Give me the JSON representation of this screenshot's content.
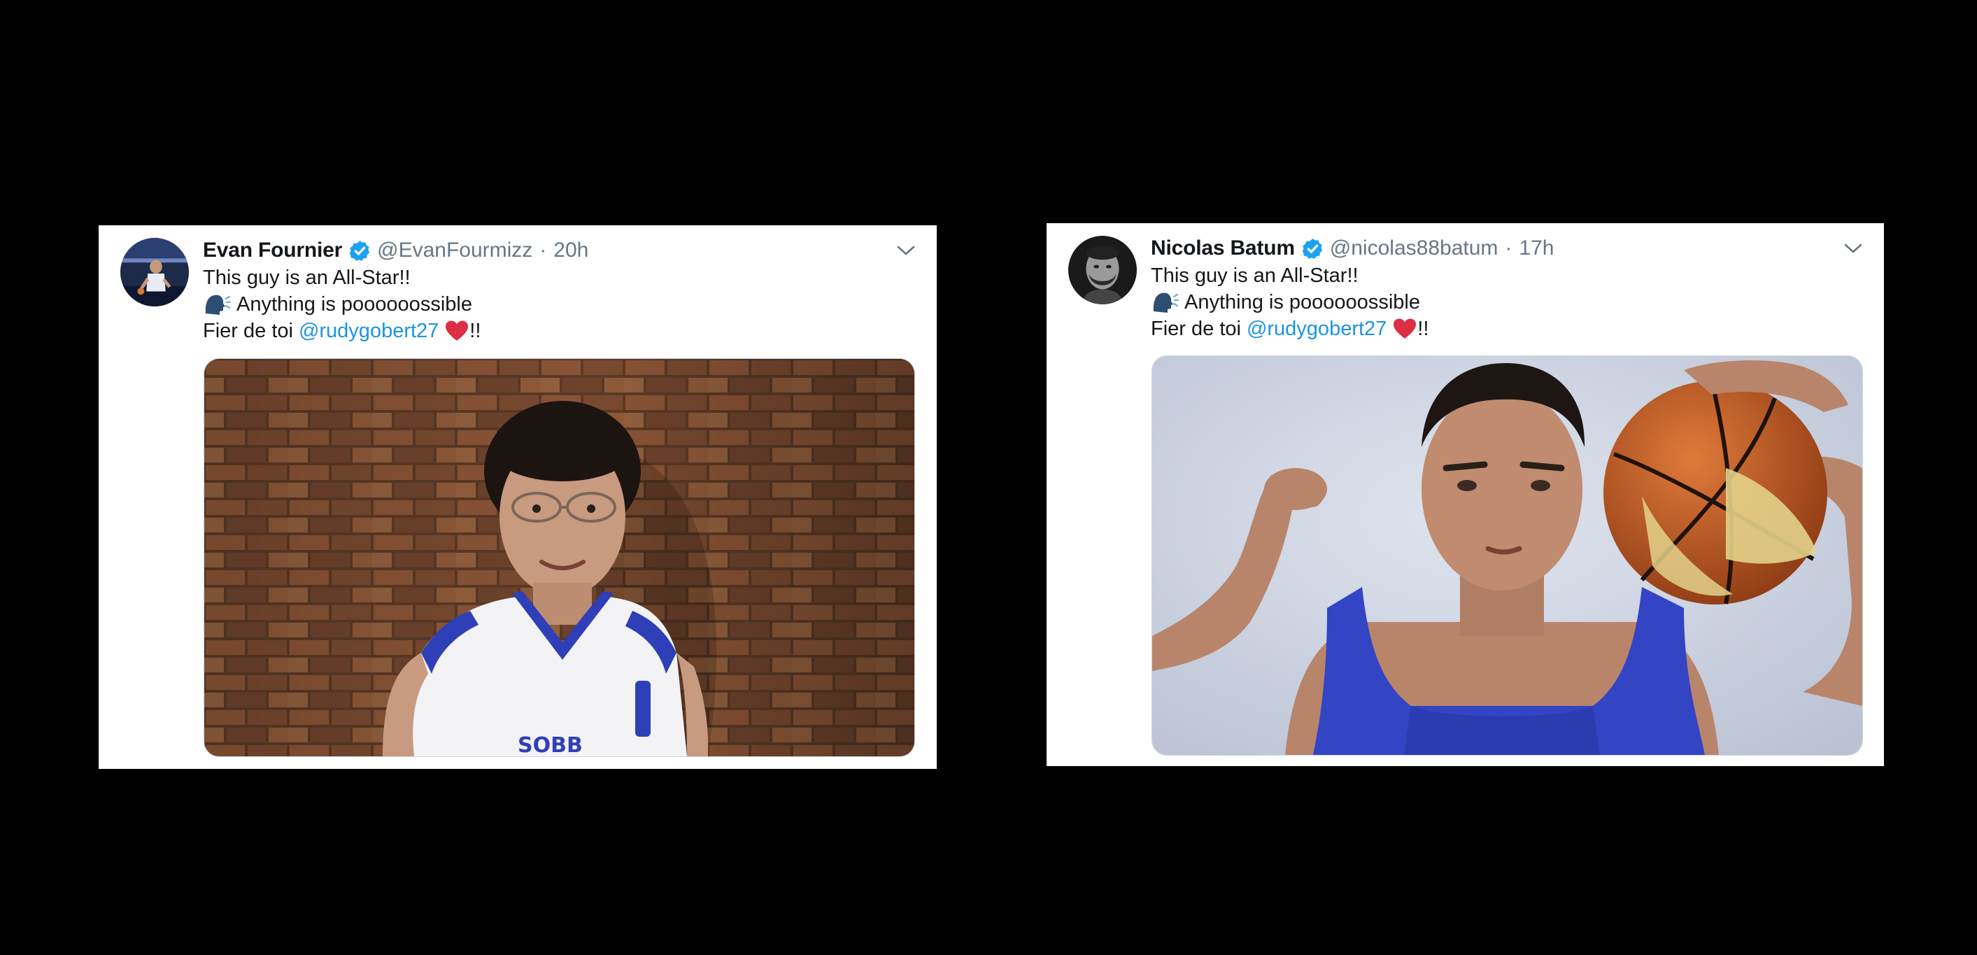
{
  "tweets": [
    {
      "display_name": "Evan Fournier",
      "handle": "@EvanFourmizz",
      "separator": "·",
      "time": "20h",
      "line1": "This guy is an All-Star!!",
      "line2": "Anything is poooooossible",
      "line3_prefix": "Fier de toi",
      "mention": "@rudygobert27",
      "line3_suffix": "!!",
      "jersey_text": "SOBB",
      "icons": [
        "speaking-head-icon",
        "red-heart-icon",
        "verified-badge-icon",
        "chevron-down-icon"
      ]
    },
    {
      "display_name": "Nicolas Batum",
      "handle": "@nicolas88batum",
      "separator": "·",
      "time": "17h",
      "line1": "This guy is an All-Star!!",
      "line2": "Anything is poooooossible",
      "line3_prefix": "Fier de toi",
      "mention": "@rudygobert27",
      "line3_suffix": "!!",
      "icons": [
        "speaking-head-icon",
        "red-heart-icon",
        "verified-badge-icon",
        "chevron-down-icon"
      ]
    }
  ],
  "colors": {
    "background": "#000000",
    "card": "#ffffff",
    "text": "#14171a",
    "muted": "#657786",
    "link": "#1b95e0",
    "verified": "#1da1f2",
    "heart": "#dd2e44"
  }
}
